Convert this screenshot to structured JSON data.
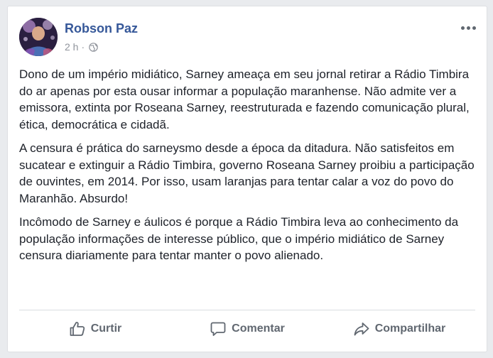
{
  "post": {
    "author": "Robson Paz",
    "time": "2 h",
    "separator": "·",
    "paragraphs": [
      "Dono de um império midiático, Sarney ameaça em seu jornal retirar a Rádio Timbira do ar apenas por esta ousar informar a população maranhense. Não admite ver a emissora, extinta por Roseana Sarney, reestruturada e fazendo comunicação plural, ética, democrática e cidadã.",
      "A censura é prática do sarneysmo desde a época da ditadura. Não satisfeitos em sucatear e extinguir a Rádio Timbira, governo Roseana Sarney proibiu a participação de ouvintes, em 2014. Por isso, usam laranjas para tentar calar a voz do povo do Maranhão. Absurdo!",
      "Incômodo de Sarney e áulicos é porque a Rádio Timbira leva ao conhecimento da população informações de interesse público, que o império midiático de Sarney censura diariamente para tentar manter o povo alienado."
    ]
  },
  "actions": {
    "like_label": "Curtir",
    "comment_label": "Comentar",
    "share_label": "Compartilhar"
  },
  "icons": {
    "audience": "globe-icon",
    "more": "more-options-icon",
    "like": "thumbs-up-icon",
    "comment": "comment-icon",
    "share": "share-icon"
  },
  "colors": {
    "author": "#365899",
    "text": "#1d2129",
    "muted": "#90949c",
    "action": "#606770",
    "background": "#e9ebee"
  }
}
